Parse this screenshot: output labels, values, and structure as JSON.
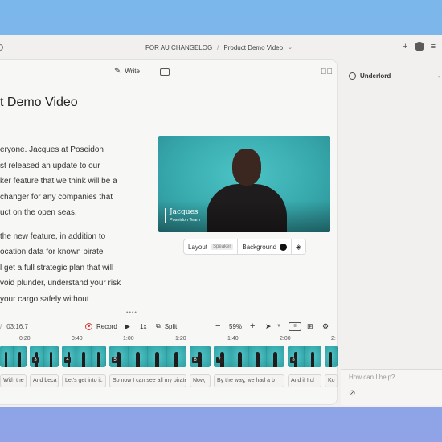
{
  "window": {
    "breadcrumb": [
      "FOR AU CHANGELOG",
      "Product Demo Video"
    ],
    "breadcrumb_sep": "/",
    "breadcrumb_chevron": "⌄"
  },
  "editor": {
    "write_label": "Write",
    "title": "t Demo Video",
    "paragraphs": [
      [
        "eryone. Jacques at Poseidon",
        "st released an update to our",
        "ker feature that we think will be a",
        " changer for any companies that",
        "uct on the open seas."
      ],
      [
        " the new feature, in addition to",
        "ocation data for known pirate",
        "l get a full strategic plan that will",
        "void plunder, understand your risk",
        " your cargo safely without"
      ]
    ]
  },
  "video": {
    "lower_third_name": "Jacques",
    "lower_third_title": "Poseidon Team",
    "layout_label": "Layout",
    "layout_value": "Speaker",
    "background_label": "Background",
    "background_color": "#111111"
  },
  "timeline": {
    "time_separator": "/",
    "duration": "03:16.7",
    "record_label": "Record",
    "speed": "1x",
    "split_label": "Split",
    "zoom": "59%",
    "ruler": [
      "0:20",
      "0:40",
      "1:00",
      "1:20",
      "1:40",
      "2:00",
      "2:"
    ],
    "clips": [
      {
        "num": ""
      },
      {
        "num": "3"
      },
      {
        "num": "4"
      },
      {
        "num": "5"
      },
      {
        "num": "6"
      },
      {
        "num": "7"
      },
      {
        "num": "8"
      },
      {
        "num": ""
      }
    ],
    "captions": [
      "With the ne",
      "And beca",
      "Let's get into it.",
      "So now I can see all my pirate",
      "Now,",
      "By the way, we had a b",
      "And if I cl",
      "Ko"
    ]
  },
  "sidebar": {
    "agent_name": "Underlord",
    "chat_placeholder": "How can I help?"
  },
  "colors": {
    "accent": "#3db8bb",
    "record": "#dd3333",
    "background_top": "#7bb7ea"
  }
}
